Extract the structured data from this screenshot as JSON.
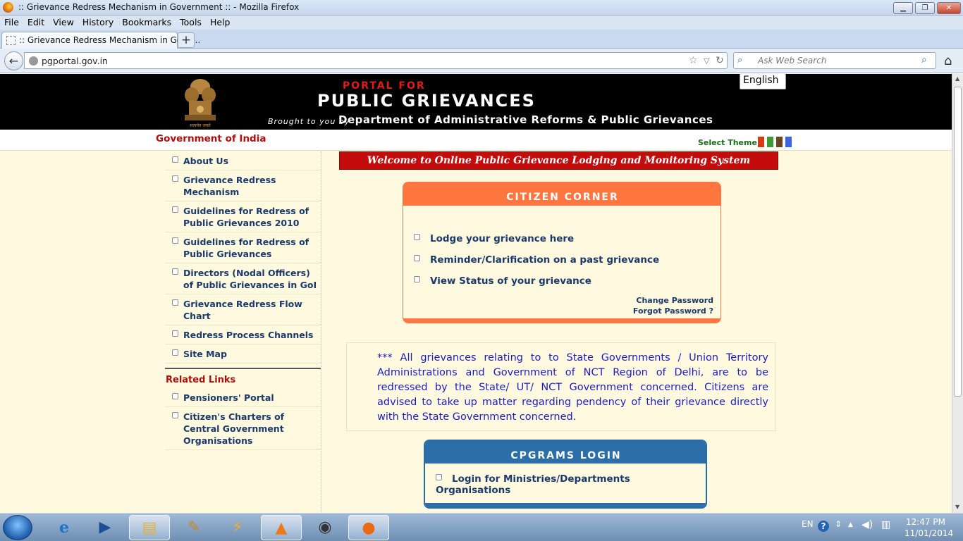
{
  "window": {
    "title": ":: Grievance Redress Mechanism in Government :: - Mozilla Firefox",
    "minimize": "▁",
    "maximize": "❐",
    "close": "✕"
  },
  "menu": [
    "File",
    "Edit",
    "View",
    "History",
    "Bookmarks",
    "Tools",
    "Help"
  ],
  "tab": {
    "label": ":: Grievance Redress Mechanism in Gove...",
    "new_tab": "+"
  },
  "nav": {
    "back": "←",
    "url": "pgportal.gov.in",
    "star": "☆",
    "dropdown": "▽",
    "reload": "↻",
    "search_placeholder": "Ask Web Search",
    "home": "⌂",
    "search_icon": "⌕"
  },
  "header": {
    "portal_for": "PORTAL FOR",
    "title": "PUBLIC GRIEVANCES",
    "brought_by": "Brought to you by",
    "department": "Department of Administrative Reforms & Public Grievances",
    "emblem_motto": "सत्यमेव जयते",
    "language": "English"
  },
  "strip": {
    "gov": "Government of India",
    "select_theme": "Select Theme",
    "theme_colors": [
      "#d83a12",
      "#3e9a34",
      "#6b4423",
      "#3a66e0"
    ]
  },
  "leftnav": {
    "items": [
      "About Us",
      "Grievance Redress Mechanism",
      "Guidelines for Redress of Public Grievances 2010",
      "Guidelines for Redress of Public Grievances",
      "Directors (Nodal Officers) of Public Grievances in GoI",
      "Grievance Redress Flow Chart",
      "Redress Process Channels",
      "Site Map"
    ],
    "related_title": "Related Links",
    "related": [
      "Pensioners' Portal",
      "Citizen's Charters of Central Government Organisations"
    ]
  },
  "main": {
    "welcome": "Welcome to Online Public Grievance Lodging and Monitoring System",
    "citizen_corner": {
      "title": "CITIZEN CORNER",
      "items": [
        "Lodge your grievance here",
        "Reminder/Clarification on a past grievance",
        "View Status of your grievance"
      ],
      "change_password": "Change Password",
      "forgot_password": "Forgot Password ?"
    },
    "note": "*** All grievances relating to to State Governments / Union Territory Administrations and Government of NCT Region of Delhi, are to be redressed by the State/ UT/ NCT Government concerned. Citizens are advised to take up matter regarding pendency of their grievance directly with the State Government concerned.",
    "cpgrams": {
      "title": "CPGRAMS LOGIN",
      "item": "Login for Ministries/Departments Organisations"
    }
  },
  "taskbar": {
    "lang": "EN",
    "time": "12:47 PM",
    "date": "11/01/2014"
  }
}
